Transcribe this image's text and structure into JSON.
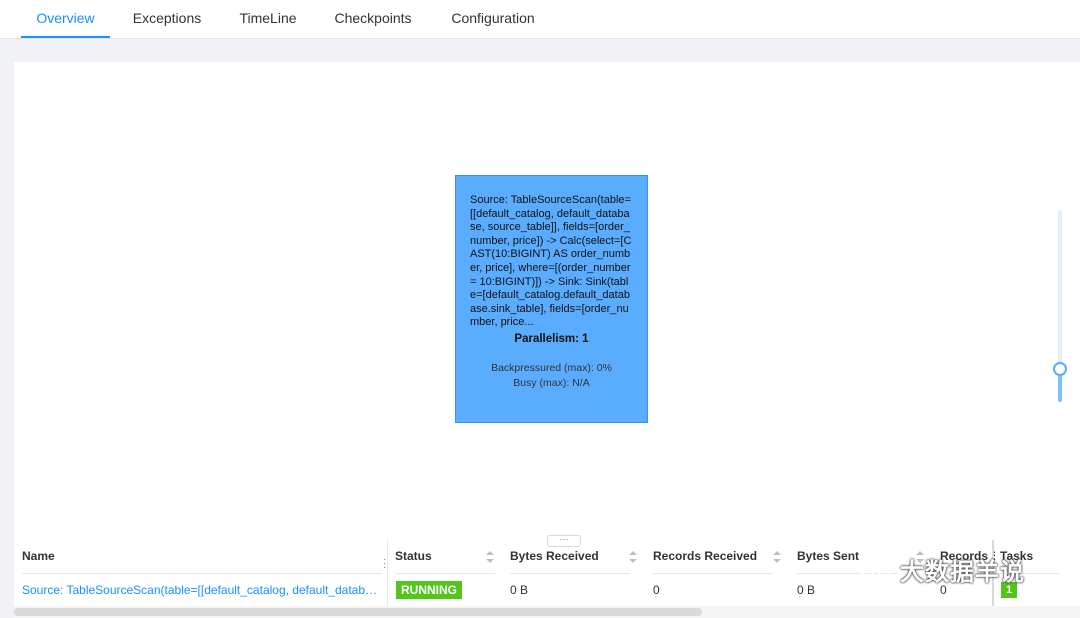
{
  "tabs": [
    {
      "label": "Overview",
      "active": true
    },
    {
      "label": "Exceptions",
      "active": false
    },
    {
      "label": "TimeLine",
      "active": false
    },
    {
      "label": "Checkpoints",
      "active": false
    },
    {
      "label": "Configuration",
      "active": false
    }
  ],
  "graph": {
    "node": {
      "description": "Source: TableSourceScan(table=[[default_catalog, default_database, source_table]], fields=[order_number, price]) -> Calc(select=[CAST(10:BIGINT) AS order_number, price], where=[(order_number = 10:BIGINT)]) -> Sink: Sink(table=[default_catalog.default_database.sink_table], fields=[order_number, price...",
      "parallelism": "Parallelism: 1",
      "backpressured": "Backpressured (max): 0%",
      "busy": "Busy (max): N/A"
    },
    "splitter_label": "···"
  },
  "table": {
    "columns": [
      "Name",
      "Status",
      "Bytes Received",
      "Records Received",
      "Bytes Sent",
      "Records S",
      "Tasks"
    ],
    "rows": [
      {
        "name": "Source: TableSourceScan(table=[[default_catalog, default_databas…",
        "status": "RUNNING",
        "bytes_received": "0 B",
        "records_received": "0",
        "bytes_sent": "0 B",
        "records_sent": "0",
        "tasks": "1"
      }
    ]
  },
  "colors": {
    "accent": "#1890ff",
    "running": "#52c41a",
    "node_fill": "#5aacff"
  },
  "watermark": {
    "text": "大数据羊说",
    "icon": "wechat-icon"
  }
}
